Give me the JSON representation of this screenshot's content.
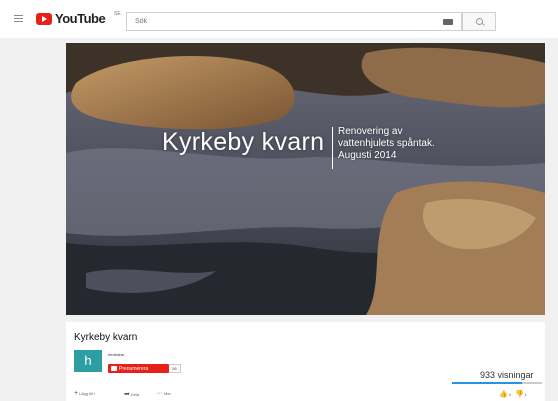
{
  "masthead": {
    "logo_text": "YouTube",
    "logo_country": "SE",
    "search_placeholder": "Sök"
  },
  "player": {
    "title": "Kyrkeby kvarn",
    "subtitle_lines": [
      "Renovering av",
      "vattenhjulets spåntak.",
      "Augusti 2014"
    ]
  },
  "video": {
    "title": "Kyrkeby kvarn",
    "channel_initial": "h",
    "channel_name": "henkitzar",
    "subscribe_label": "Prenumerera",
    "subscriber_count": "56",
    "views": "933 visningar",
    "likes_ratio": 0.78,
    "actions": {
      "add_label": "Lägg till i",
      "share_label": "Dela",
      "more_label": "Mer"
    },
    "likes": "4",
    "dislikes": "1"
  },
  "colors": {
    "accent": "#e62117",
    "avatar": "#2e9ea3",
    "view_bar": "#2793e6"
  },
  "icons": [
    "menu-icon",
    "youtube-play-icon",
    "keyboard-icon",
    "search-icon",
    "add-icon",
    "share-icon",
    "more-icon",
    "like-icon",
    "dislike-icon"
  ]
}
